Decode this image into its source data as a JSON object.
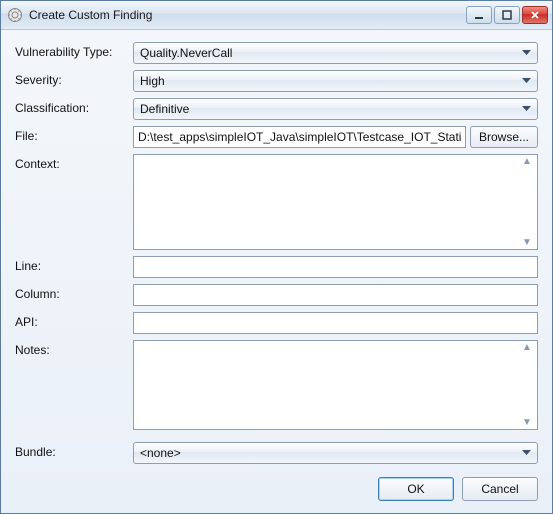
{
  "window": {
    "title": "Create Custom Finding"
  },
  "labels": {
    "vulnerability_type": "Vulnerability Type:",
    "severity": "Severity:",
    "classification": "Classification:",
    "file": "File:",
    "context": "Context:",
    "line": "Line:",
    "column": "Column:",
    "api": "API:",
    "notes": "Notes:",
    "bundle": "Bundle:"
  },
  "values": {
    "vulnerability_type": "Quality.NeverCall",
    "severity": "High",
    "classification": "Definitive",
    "file": "D:\\test_apps\\simpleIOT_Java\\simpleIOT\\Testcase_IOT_Static.ja",
    "context": "",
    "line": "",
    "column": "",
    "api": "",
    "notes": "",
    "bundle": "<none>"
  },
  "buttons": {
    "browse": "Browse...",
    "ok": "OK",
    "cancel": "Cancel"
  }
}
